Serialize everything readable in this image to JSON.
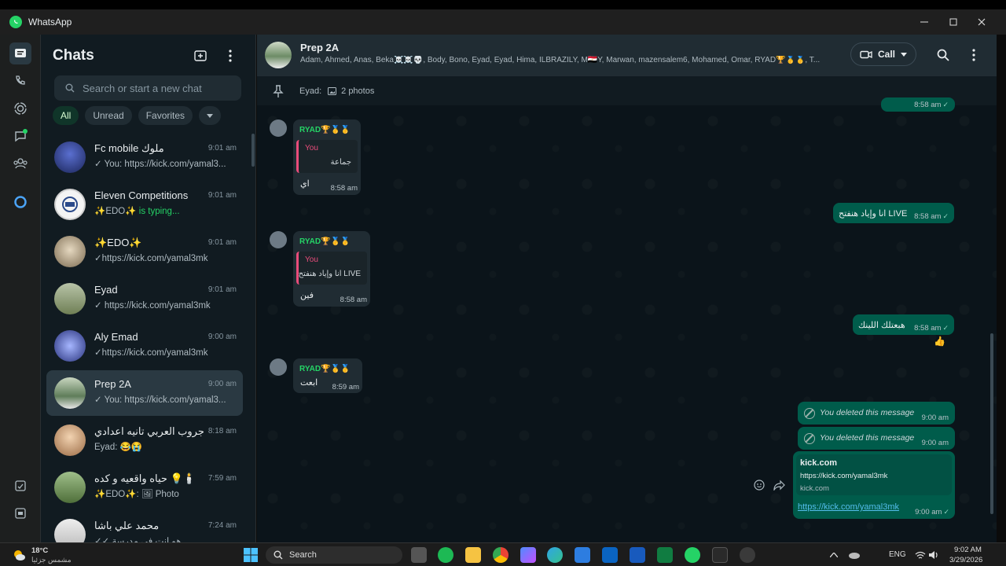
{
  "window": {
    "title": "WhatsApp"
  },
  "sidebar": {
    "title": "Chats",
    "search_placeholder": "Search or start a new chat",
    "filters": [
      "All",
      "Unread",
      "Favorites"
    ],
    "chats": [
      {
        "name": "Fc mobile ملوك",
        "time": "9:01 am",
        "last": "✓ You: https://kick.com/yamal3...",
        "avatar_color": "#2b3a8a"
      },
      {
        "name": "Eleven Competitions",
        "time": "9:01 am",
        "last_prefix": "✨EDO✨ ",
        "last_typing": "is typing...",
        "avatar_color": "#f0f0f0"
      },
      {
        "name": "✨EDO✨",
        "time": "9:01 am",
        "last": "✓https://kick.com/yamal3mk",
        "avatar_color": "#d8cbb0"
      },
      {
        "name": "Eyad",
        "time": "9:01 am",
        "last": "✓ https://kick.com/yamal3mk",
        "avatar_color": "#8a9a70"
      },
      {
        "name": "Aly Emad",
        "time": "9:00 am",
        "last": "✓https://kick.com/yamal3mk",
        "avatar_color": "#3a4fa8"
      },
      {
        "name": "Prep 2A",
        "time": "9:00 am",
        "last": "✓ You: https://kick.com/yamal3...",
        "avatar_color": "#6f8f6a"
      },
      {
        "name": "جروب العربي تانيه اعدادي",
        "time": "8:18 am",
        "last": "Eyad: 😂😭",
        "avatar_color": "#c9a27a"
      },
      {
        "name": "حياه واقعيه و كده 💡🕯️",
        "time": "7:59 am",
        "last": "✨EDO✨: 🖼 Photo",
        "avatar_color": "#6d8c5a"
      },
      {
        "name": "محمد علي باشا",
        "time": "7:24 am",
        "last": "✓✓ هو انت في مدرسة",
        "avatar_color": "#d6d6d6"
      }
    ]
  },
  "header": {
    "group_name": "Prep 2A",
    "members": "Adam, Ahmed, Anas, Beka☠️☠️💀, Body, Bono, Eyad, Eyad, Hima, ILBRAZILY, M🇪🇬Y, Marwan, mazensalem6, Mohamed, Omar, RYAD🏆🥇🥇, T...",
    "call_label": "Call"
  },
  "pinned": {
    "sender": "Eyad:",
    "content": "2 photos"
  },
  "messages": {
    "top_time": "8:58 am",
    "m1": {
      "sender": "RYAD🏆🥇🥇",
      "quote_name": "You",
      "quote_text": "جماعة",
      "text": "اي",
      "time": "8:58 am"
    },
    "m2": {
      "text": "انا وإياد هنفتح LIVE",
      "time": "8:58 am"
    },
    "m3": {
      "sender": "RYAD🏆🥇🥇",
      "quote_name": "You",
      "quote_text": "انا وإياد هنفتح LIVE",
      "text": "فين",
      "time": "8:58 am"
    },
    "m4": {
      "text": "هبعتلك اللينك",
      "time": "8:58 am",
      "reaction": "👍"
    },
    "m5": {
      "sender": "RYAD🏆🥇🥇",
      "text": "ابعت",
      "time": "8:59 am"
    },
    "d1": {
      "text": "You deleted this message",
      "time": "9:00 am"
    },
    "d2": {
      "text": "You deleted this message",
      "time": "9:00 am"
    },
    "link": {
      "title": "kick.com",
      "url_preview": "https://kick.com/yamal3mk",
      "domain": "kick.com",
      "url": "https://kick.com/yamal3mk",
      "time": "9:00 am"
    }
  },
  "taskbar": {
    "weather_temp": "18°C",
    "weather_desc": "مشمس جزئيا",
    "search_label": "Search",
    "lang": "ENG",
    "time": "9:02 AM",
    "date": "3/29/2026"
  },
  "colors": {
    "accent": "#25d366",
    "outgoing": "#005c4b",
    "incoming": "#202c33",
    "quote_bar": "#e94c7b"
  }
}
